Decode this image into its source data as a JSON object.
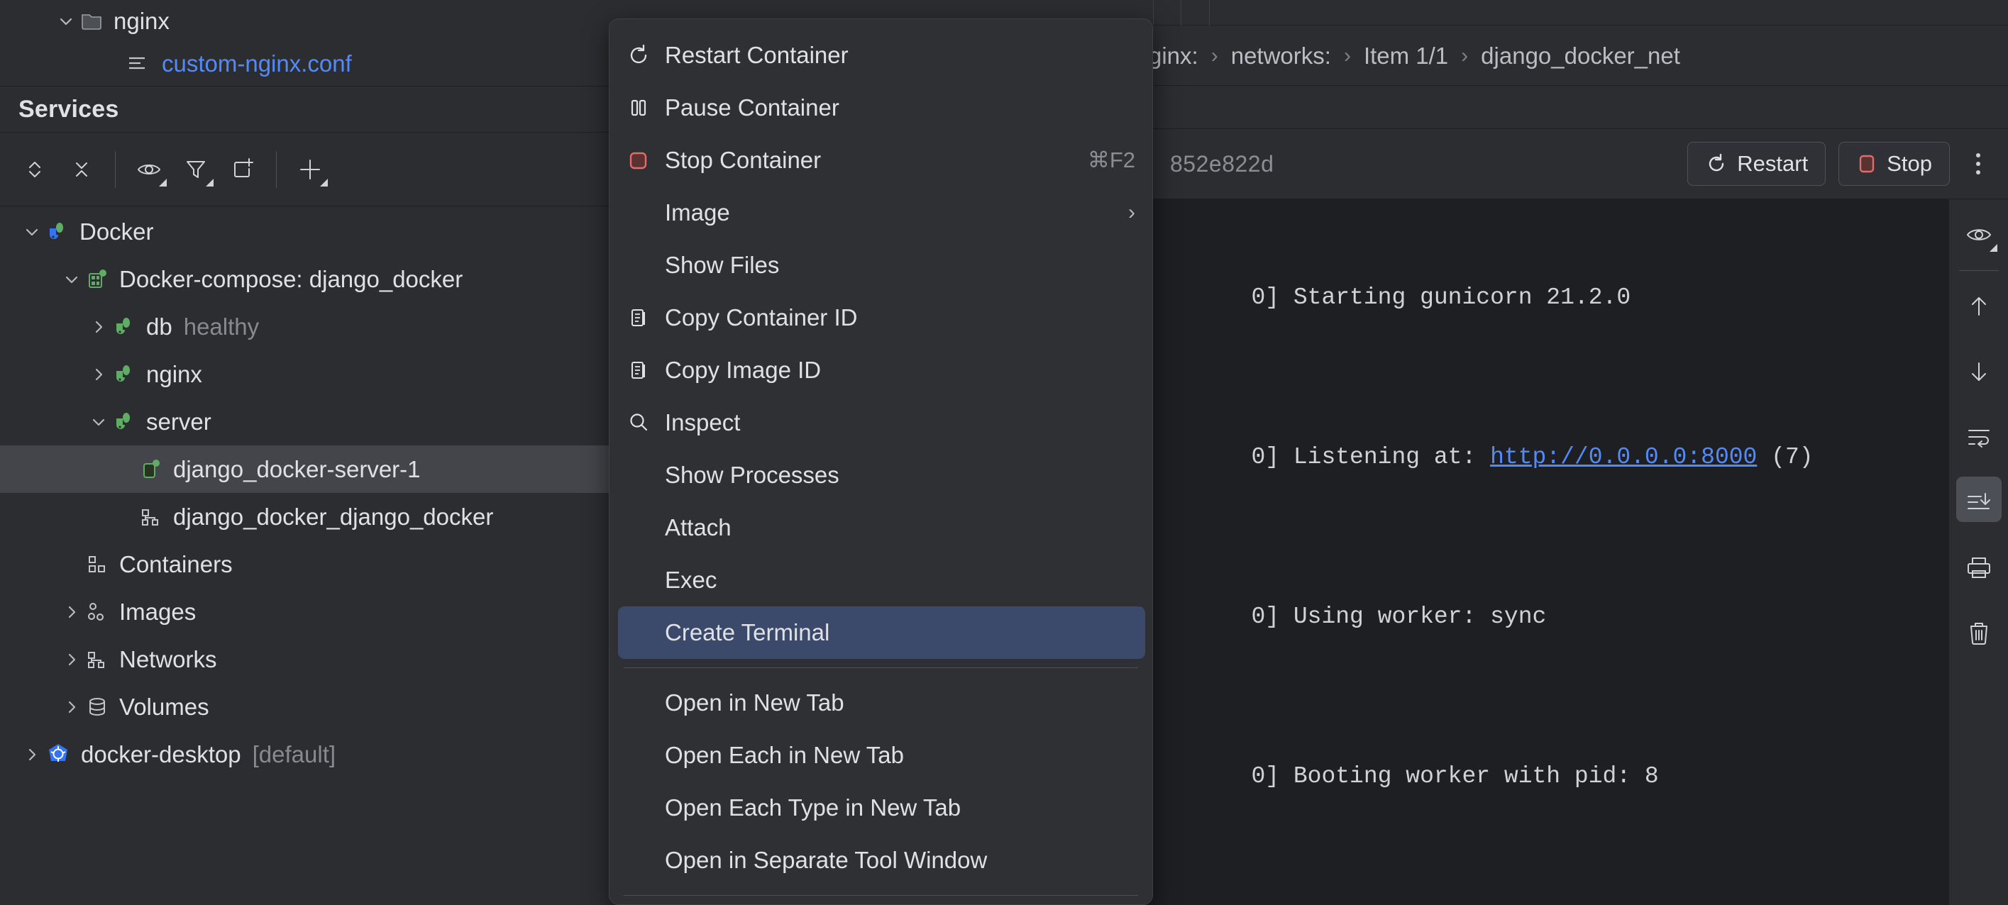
{
  "project_tree": {
    "items": [
      {
        "label": "nginx",
        "icon": "folder-icon",
        "expanded": true,
        "style": "normal"
      },
      {
        "label": "custom-nginx.conf",
        "icon": "config-file-icon",
        "expanded": null,
        "style": "link"
      }
    ]
  },
  "services_panel": {
    "title": "Services",
    "toolbar": [
      {
        "name": "expand-all-icon",
        "has_dropdown": false
      },
      {
        "name": "collapse-all-icon",
        "has_dropdown": false
      },
      {
        "name": "separator",
        "has_dropdown": false
      },
      {
        "name": "eye-icon",
        "has_dropdown": true
      },
      {
        "name": "filter-icon",
        "has_dropdown": true
      },
      {
        "name": "new-tab-icon",
        "has_dropdown": false
      },
      {
        "name": "separator",
        "has_dropdown": false
      },
      {
        "name": "plus-icon",
        "has_dropdown": true
      }
    ],
    "tree": [
      {
        "label": "Docker",
        "status": "",
        "indent": 0,
        "chevron": "down",
        "icon": "docker-icon",
        "selected": false
      },
      {
        "label": "Docker-compose: django_docker",
        "status": "",
        "indent": 1,
        "chevron": "down",
        "icon": "compose-icon",
        "selected": false
      },
      {
        "label": "db",
        "status": "healthy",
        "indent": 2,
        "chevron": "right",
        "icon": "docker-green-icon",
        "selected": false
      },
      {
        "label": "nginx",
        "status": "",
        "indent": 2,
        "chevron": "right",
        "icon": "docker-green-icon",
        "selected": false
      },
      {
        "label": "server",
        "status": "",
        "indent": 2,
        "chevron": "down",
        "icon": "docker-green-icon",
        "selected": false
      },
      {
        "label": "django_docker-server-1",
        "status": "",
        "indent": 3,
        "chevron": "none",
        "icon": "container-icon",
        "selected": true
      },
      {
        "label": "django_docker_django_docker",
        "status": "",
        "indent": 3,
        "chevron": "none",
        "icon": "network-icon",
        "selected": false
      },
      {
        "label": "Containers",
        "status": "",
        "indent": 1,
        "chevron": "none",
        "icon": "containers-icon",
        "selected": false
      },
      {
        "label": "Images",
        "status": "",
        "indent": 1,
        "chevron": "right",
        "icon": "images-icon",
        "selected": false
      },
      {
        "label": "Networks",
        "status": "",
        "indent": 1,
        "chevron": "right",
        "icon": "network-icon",
        "selected": false
      },
      {
        "label": "Volumes",
        "status": "",
        "indent": 1,
        "chevron": "right",
        "icon": "volumes-icon",
        "selected": false
      },
      {
        "label": "docker-desktop",
        "status": "[default]",
        "indent": 0,
        "chevron": "right",
        "icon": "kubernetes-icon",
        "selected": false
      }
    ]
  },
  "breadcrumb": {
    "items": [
      "ginx:",
      "networks:",
      "Item 1/1",
      "django_docker_net"
    ],
    "separator": "›"
  },
  "container_toolbar": {
    "container_id": "852e822d",
    "restart_label": "Restart",
    "stop_label": "Stop",
    "restart_icon": "restart-icon",
    "stop_icon": "stop-square-icon",
    "more_icon": "kebab-menu-icon"
  },
  "console": {
    "lines": [
      {
        "prefix": "0] Starting gunicorn 21.2.0",
        "link": "",
        "suffix": ""
      },
      {
        "prefix": "0] Listening at: ",
        "link": "http://0.0.0.0:8000",
        "suffix": " (7)"
      },
      {
        "prefix": "0] Using worker: sync",
        "link": "",
        "suffix": ""
      },
      {
        "prefix": "0] Booting worker with pid: 8",
        "link": "",
        "suffix": ""
      }
    ]
  },
  "console_toolbar": [
    {
      "name": "eye-soft-wrap-icon",
      "has_dropdown": true,
      "active": false
    },
    {
      "name": "separator",
      "has_dropdown": false,
      "active": false
    },
    {
      "name": "arrow-up-icon",
      "has_dropdown": false,
      "active": false
    },
    {
      "name": "arrow-down-icon",
      "has_dropdown": false,
      "active": false
    },
    {
      "name": "soft-wrap-icon",
      "has_dropdown": false,
      "active": false
    },
    {
      "name": "scroll-to-end-icon",
      "has_dropdown": false,
      "active": true
    },
    {
      "name": "print-icon",
      "has_dropdown": false,
      "active": false
    },
    {
      "name": "trash-icon",
      "has_dropdown": false,
      "active": false
    }
  ],
  "context_menu": {
    "groups": [
      {
        "items": [
          {
            "label": "Restart Container",
            "icon": "restart-icon",
            "accel": "",
            "arrow": false,
            "highlighted": false
          },
          {
            "label": "Pause Container",
            "icon": "pause-icon",
            "accel": "",
            "arrow": false,
            "highlighted": false
          },
          {
            "label": "Stop Container",
            "icon": "stop-square-icon",
            "accel": "⌘F2",
            "arrow": false,
            "highlighted": false
          },
          {
            "label": "Image",
            "icon": "none",
            "accel": "",
            "arrow": true,
            "highlighted": false
          },
          {
            "label": "Show Files",
            "icon": "none",
            "accel": "",
            "arrow": false,
            "highlighted": false
          },
          {
            "label": "Copy Container ID",
            "icon": "copy-icon",
            "accel": "",
            "arrow": false,
            "highlighted": false
          },
          {
            "label": "Copy Image ID",
            "icon": "copy-icon",
            "accel": "",
            "arrow": false,
            "highlighted": false
          },
          {
            "label": "Inspect",
            "icon": "search-icon",
            "accel": "",
            "arrow": false,
            "highlighted": false
          },
          {
            "label": "Show Processes",
            "icon": "none",
            "accel": "",
            "arrow": false,
            "highlighted": false
          },
          {
            "label": "Attach",
            "icon": "none",
            "accel": "",
            "arrow": false,
            "highlighted": false
          },
          {
            "label": "Exec",
            "icon": "none",
            "accel": "",
            "arrow": false,
            "highlighted": false
          },
          {
            "label": "Create Terminal",
            "icon": "none",
            "accel": "",
            "arrow": false,
            "highlighted": true
          }
        ]
      },
      {
        "items": [
          {
            "label": "Open in New Tab",
            "icon": "none",
            "accel": "",
            "arrow": false,
            "highlighted": false
          },
          {
            "label": "Open Each in New Tab",
            "icon": "none",
            "accel": "",
            "arrow": false,
            "highlighted": false
          },
          {
            "label": "Open Each Type in New Tab",
            "icon": "none",
            "accel": "",
            "arrow": false,
            "highlighted": false
          },
          {
            "label": "Open in Separate Tool Window",
            "icon": "none",
            "accel": "",
            "arrow": false,
            "highlighted": false
          }
        ]
      }
    ]
  },
  "colors": {
    "bg": "#2b2d30",
    "console_bg": "#1e1f22",
    "menu_bg": "#2f3034",
    "highlight": "#3b4a6b",
    "link": "#548af7",
    "selected_row": "#43454a",
    "text": "#dfe1e5",
    "dim_text": "#868a91",
    "docker_blue": "#3574f0",
    "docker_green": "#5fad65",
    "stop_red": "#e06c6c"
  }
}
